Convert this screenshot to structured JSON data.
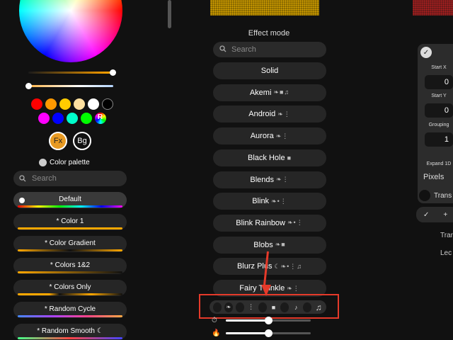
{
  "colors": {
    "accent": "#e89a22",
    "highlight": "#e53a2a",
    "panel_bg": "#262626",
    "page_bg": "#111111"
  },
  "color_picker": {
    "brightness_value": 100,
    "cct_value": 0,
    "swatches_row1": [
      "#ff0000",
      "#ff9900",
      "#ffcc00",
      "#ffe0a0",
      "#ffffff",
      "#000000"
    ],
    "swatches_row2": [
      "#ff00ff",
      "#0000ff",
      "#00ffcc",
      "#00ff00"
    ],
    "random_swatch_label": "R",
    "fx_label": "Fx",
    "bg_label": "Bg"
  },
  "palette": {
    "title": "Color palette",
    "search_placeholder": "Search",
    "items": [
      {
        "label": "Default",
        "selected": true,
        "gradient": "linear-gradient(90deg,#ff0000,#ffff00,#00ff00,#00ffff,#0000ff,#ff00ff)"
      },
      {
        "label": "* Color 1",
        "selected": false,
        "gradient": "linear-gradient(90deg,#ffa800,#ffa800)"
      },
      {
        "label": "* Color Gradient",
        "selected": false,
        "gradient": "linear-gradient(90deg,#ffa800,#111111 50%,#ffa800)"
      },
      {
        "label": "* Colors 1&2",
        "selected": false,
        "gradient": "linear-gradient(90deg,#ffa800,#111111)"
      },
      {
        "label": "* Colors Only",
        "selected": false,
        "gradient": "linear-gradient(90deg,#ffa800 30%,#111111 40%,#ffa800 70%,#111111)"
      },
      {
        "label": "* Random Cycle",
        "selected": false,
        "gradient": "linear-gradient(90deg,#4488ff,#aa44ff,#ff4488,#ffaa44)"
      },
      {
        "label": "* Random Smooth ☾",
        "selected": false,
        "gradient": "linear-gradient(90deg,#44ff88,#ff4444,#4444ff)"
      }
    ]
  },
  "effects": {
    "title": "Effect mode",
    "search_placeholder": "Search",
    "items": [
      {
        "name": "Solid",
        "flags": ""
      },
      {
        "name": "Akemi",
        "flags": "❧■♫"
      },
      {
        "name": "Android",
        "flags": "❧⋮"
      },
      {
        "name": "Aurora",
        "flags": "❧⋮"
      },
      {
        "name": "Black Hole",
        "flags": "■"
      },
      {
        "name": "Blends",
        "flags": "❧⋮"
      },
      {
        "name": "Blink",
        "flags": "❧•⋮"
      },
      {
        "name": "Blink Rainbow",
        "flags": "❧•⋮"
      },
      {
        "name": "Blobs",
        "flags": "❧■"
      },
      {
        "name": "Blurz Plus",
        "flags": "☾❧•⋮♫"
      },
      {
        "name": "Fairy Twinkle",
        "flags": "❧⋮"
      }
    ],
    "filter_symbols": [
      "❧",
      "⋮",
      "■",
      "♪",
      "♫"
    ],
    "speed": 50,
    "intensity": 50
  },
  "segment": {
    "start_x_label": "Start X",
    "start_x": "0",
    "start_y_label": "Start Y",
    "start_y": "0",
    "grouping_label": "Grouping",
    "grouping": "1",
    "expand_label": "Expand 1D",
    "mapping": "Pixels",
    "transpose_label": "Trans",
    "add_label": "+",
    "right_text_1": "Tran",
    "right_text_2": "Lec"
  }
}
